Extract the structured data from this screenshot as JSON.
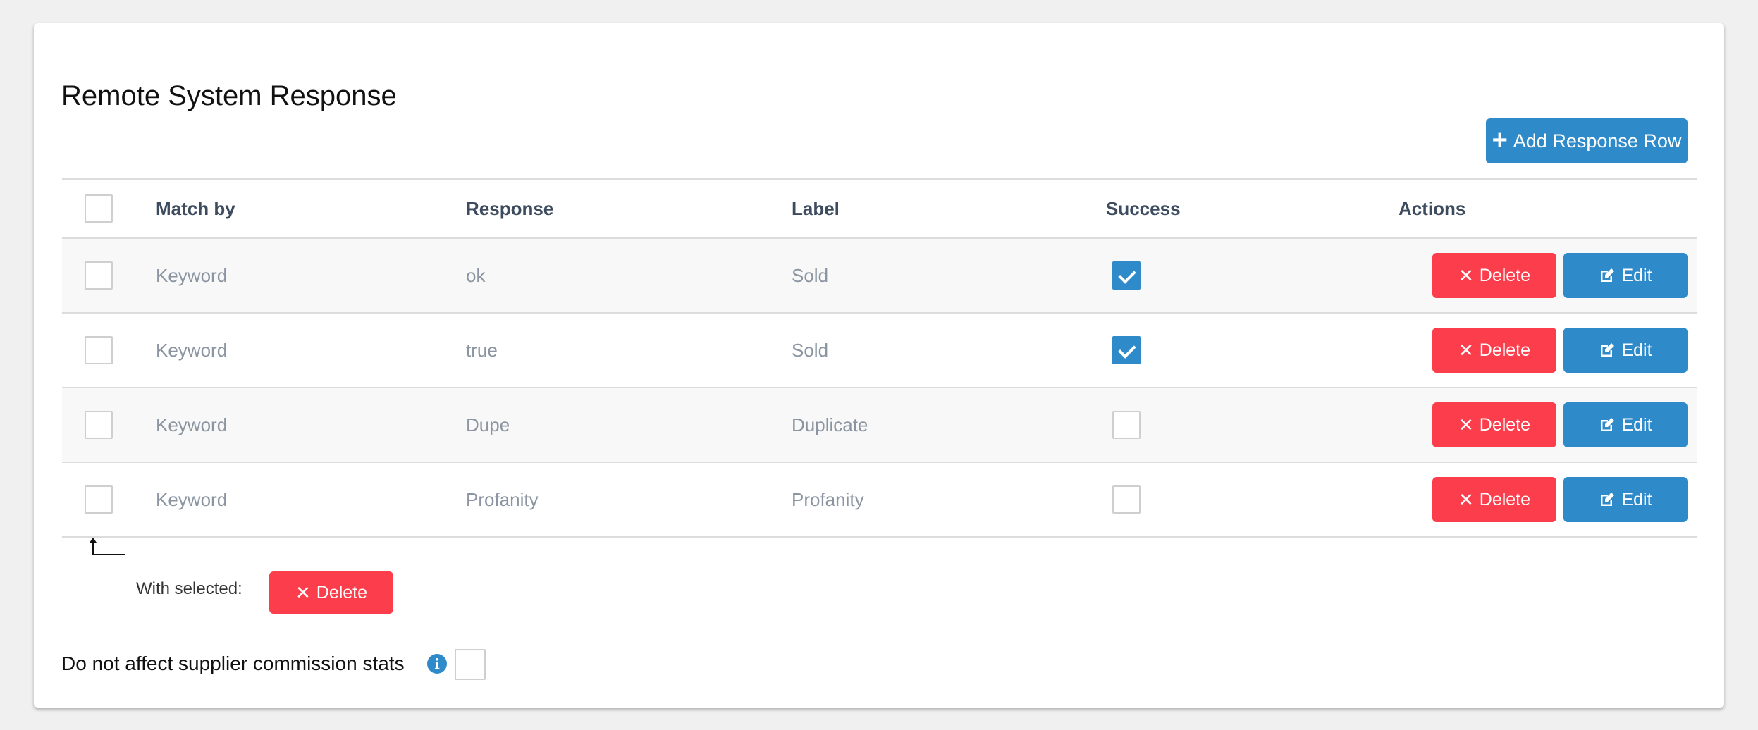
{
  "page": {
    "title": "Remote System Response",
    "add_button_label": "Add Response Row"
  },
  "table": {
    "headers": {
      "match_by": "Match by",
      "response": "Response",
      "label": "Label",
      "success": "Success",
      "actions": "Actions"
    },
    "rows": [
      {
        "match_by": "Keyword",
        "response": "ok",
        "label": "Sold",
        "success": true
      },
      {
        "match_by": "Keyword",
        "response": "true",
        "label": "Sold",
        "success": true
      },
      {
        "match_by": "Keyword",
        "response": "Dupe",
        "label": "Duplicate",
        "success": false
      },
      {
        "match_by": "Keyword",
        "response": "Profanity",
        "label": "Profanity",
        "success": false
      }
    ],
    "delete_label": "Delete",
    "edit_label": "Edit"
  },
  "bulk": {
    "with_selected_label": "With selected:",
    "delete_label": "Delete"
  },
  "stats": {
    "label": "Do not affect supplier commission stats",
    "checked": false
  },
  "colors": {
    "primary": "#2f8ac9",
    "danger": "#fb3d4c"
  },
  "icons": {
    "add": "plus-icon",
    "delete": "times-icon",
    "edit": "edit-icon",
    "info": "info-icon",
    "arrow": "corner-arrow-icon"
  }
}
